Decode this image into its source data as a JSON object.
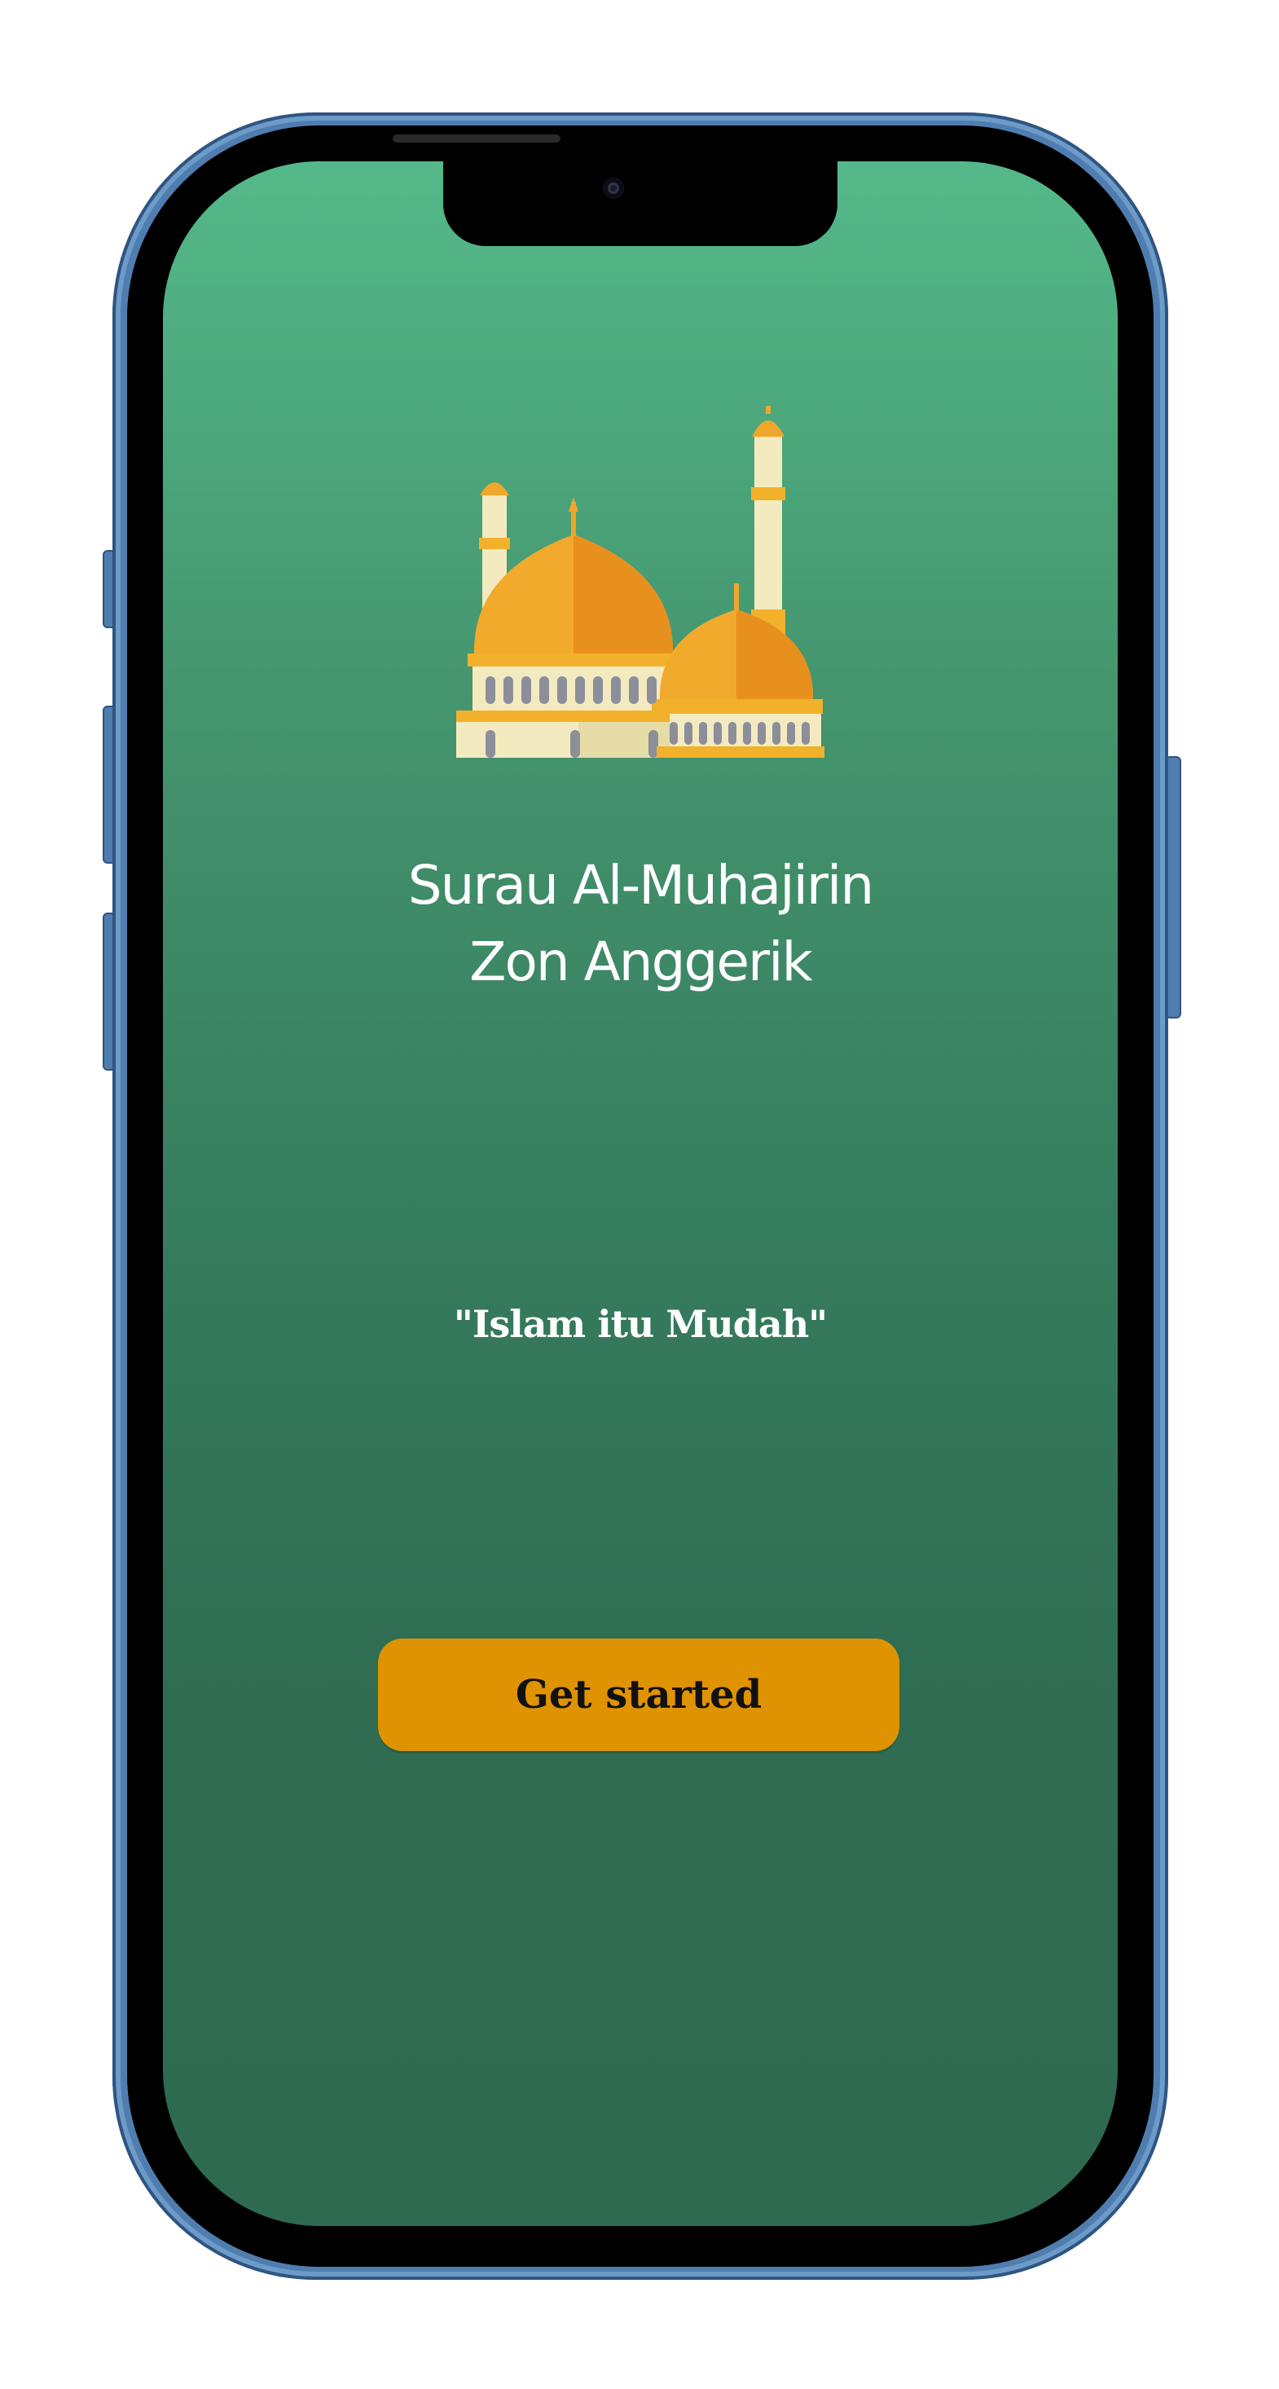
{
  "app": {
    "title_line1": "Surau Al-Muhajirin",
    "title_line2": "Zon Anggerik",
    "tagline": "\"Islam itu Mudah\"",
    "cta_label": "Get started"
  },
  "icons": {
    "logo": "mosque-icon"
  },
  "colors": {
    "gradient_top": "#54b98a",
    "gradient_bottom": "#2e6a50",
    "button": "#e09300",
    "dome_orange": "#f0a62a",
    "device_frame": "#4f7daf"
  }
}
